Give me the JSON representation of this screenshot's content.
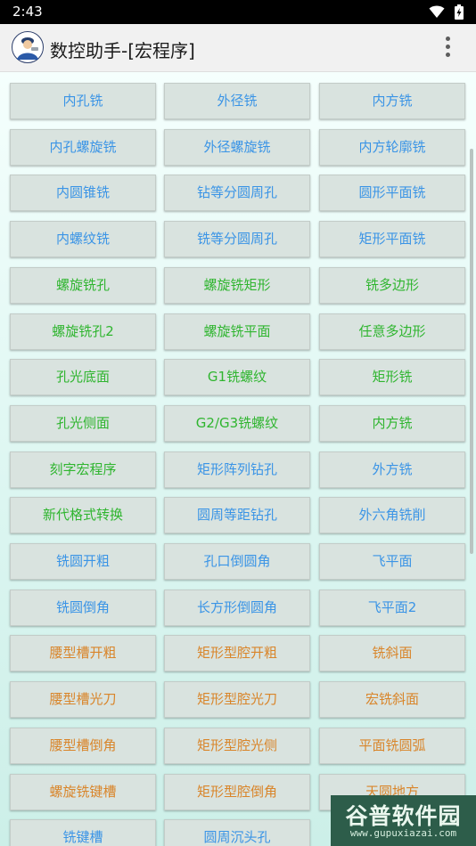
{
  "status_bar": {
    "time": "2:43",
    "icons": [
      "wifi-icon",
      "battery-charging-icon"
    ]
  },
  "app_bar": {
    "title": "数控助手-[宏程序]",
    "icon": "machinist-avatar-icon",
    "menu_icon": "overflow-menu-icon"
  },
  "colors": {
    "blue": "#3a94e6",
    "green": "#2fb52f",
    "orange": "#d9852a",
    "button_bg": "#d9e3df"
  },
  "grid": {
    "buttons": [
      {
        "label": "内孔铣",
        "color": "blue"
      },
      {
        "label": "外径铣",
        "color": "blue"
      },
      {
        "label": "内方铣",
        "color": "blue"
      },
      {
        "label": "内孔螺旋铣",
        "color": "blue"
      },
      {
        "label": "外径螺旋铣",
        "color": "blue"
      },
      {
        "label": "内方轮廓铣",
        "color": "blue"
      },
      {
        "label": "内圆锥铣",
        "color": "blue"
      },
      {
        "label": "钻等分圆周孔",
        "color": "blue"
      },
      {
        "label": "圆形平面铣",
        "color": "blue"
      },
      {
        "label": "内螺纹铣",
        "color": "blue"
      },
      {
        "label": "铣等分圆周孔",
        "color": "blue"
      },
      {
        "label": "矩形平面铣",
        "color": "blue"
      },
      {
        "label": "螺旋铣孔",
        "color": "green"
      },
      {
        "label": "螺旋铣矩形",
        "color": "green"
      },
      {
        "label": "铣多边形",
        "color": "green"
      },
      {
        "label": "螺旋铣孔2",
        "color": "green"
      },
      {
        "label": "螺旋铣平面",
        "color": "green"
      },
      {
        "label": "任意多边形",
        "color": "green"
      },
      {
        "label": "孔光底面",
        "color": "green"
      },
      {
        "label": "G1铣螺纹",
        "color": "green"
      },
      {
        "label": "矩形铣",
        "color": "green"
      },
      {
        "label": "孔光侧面",
        "color": "green"
      },
      {
        "label": "G2/G3铣螺纹",
        "color": "green"
      },
      {
        "label": "内方铣",
        "color": "green"
      },
      {
        "label": "刻字宏程序",
        "color": "green"
      },
      {
        "label": "矩形阵列钻孔",
        "color": "blue"
      },
      {
        "label": "外方铣",
        "color": "blue"
      },
      {
        "label": "新代格式转换",
        "color": "green"
      },
      {
        "label": "圆周等距钻孔",
        "color": "blue"
      },
      {
        "label": "外六角铣削",
        "color": "blue"
      },
      {
        "label": "铣圆开粗",
        "color": "blue"
      },
      {
        "label": "孔口倒圆角",
        "color": "blue"
      },
      {
        "label": "飞平面",
        "color": "blue"
      },
      {
        "label": "铣圆倒角",
        "color": "blue"
      },
      {
        "label": "长方形倒圆角",
        "color": "blue"
      },
      {
        "label": "飞平面2",
        "color": "blue"
      },
      {
        "label": "腰型槽开粗",
        "color": "orange"
      },
      {
        "label": "矩形型腔开粗",
        "color": "orange"
      },
      {
        "label": "铣斜面",
        "color": "orange"
      },
      {
        "label": "腰型槽光刀",
        "color": "orange"
      },
      {
        "label": "矩形型腔光刀",
        "color": "orange"
      },
      {
        "label": "宏铣斜面",
        "color": "orange"
      },
      {
        "label": "腰型槽倒角",
        "color": "orange"
      },
      {
        "label": "矩形型腔光侧",
        "color": "orange"
      },
      {
        "label": "平面铣圆弧",
        "color": "orange"
      },
      {
        "label": "螺旋铣键槽",
        "color": "orange"
      },
      {
        "label": "矩形型腔倒角",
        "color": "orange"
      },
      {
        "label": "天圆地方",
        "color": "orange"
      },
      {
        "label": "铣键槽",
        "color": "blue"
      },
      {
        "label": "圆周沉头孔",
        "color": "blue"
      }
    ]
  },
  "watermark": {
    "text": "谷普软件园",
    "url": "www.gupuxiazai.com"
  }
}
